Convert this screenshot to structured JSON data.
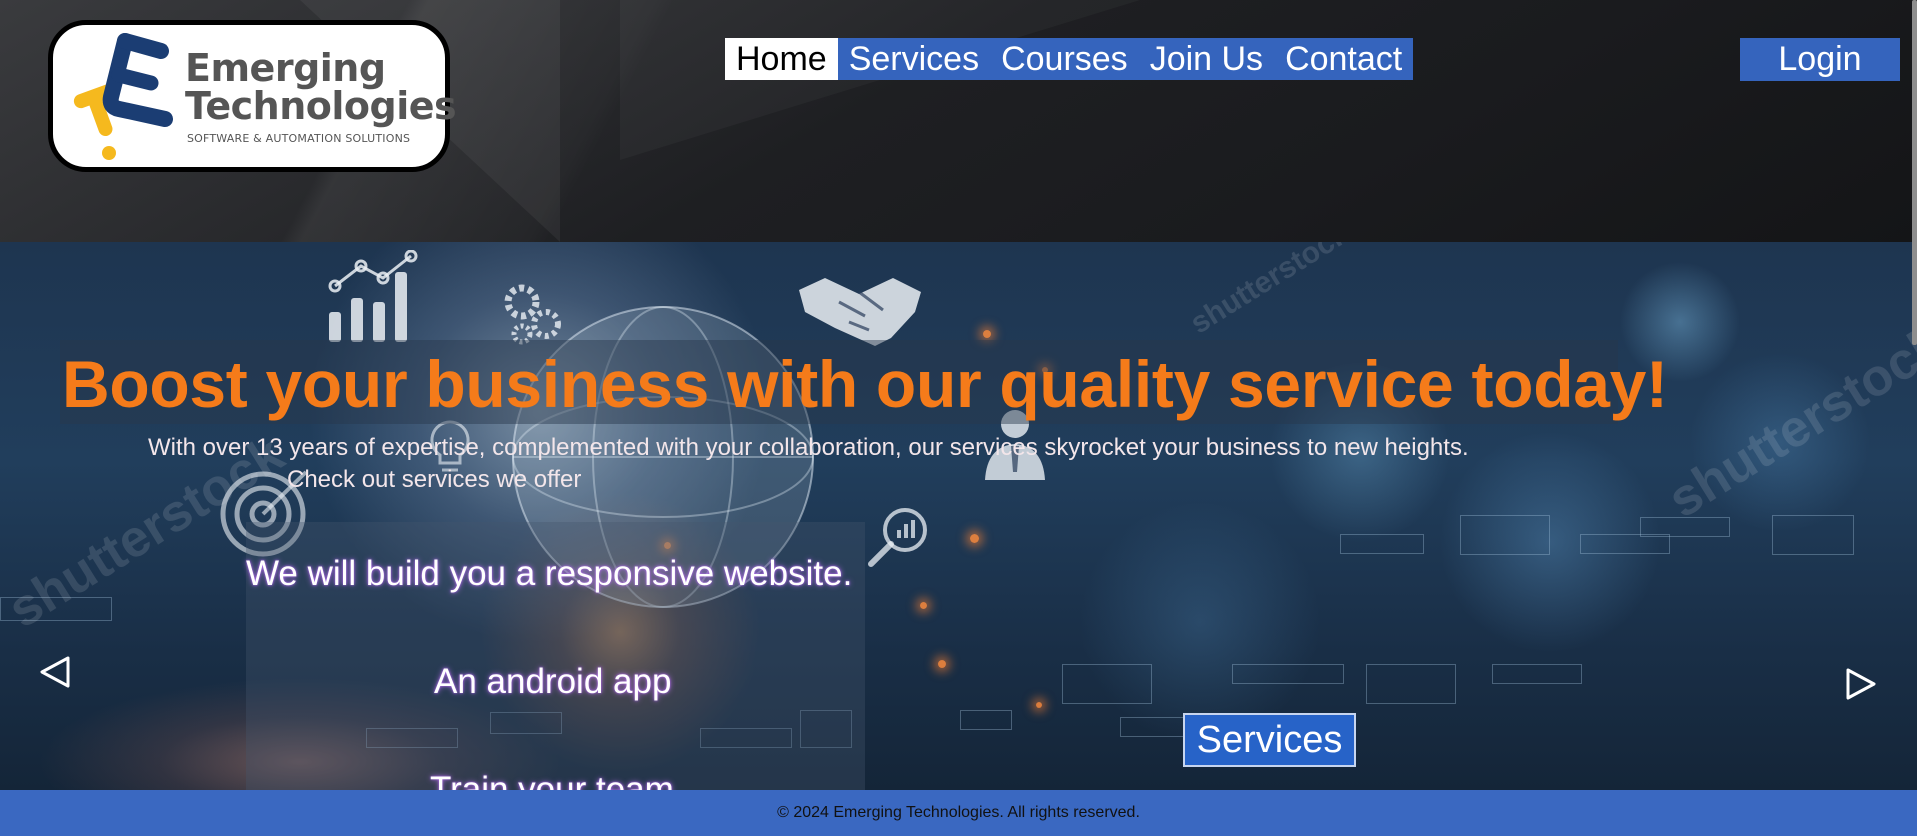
{
  "logo": {
    "line1": "Emerging",
    "line2": "Technologies",
    "tagline": "SOFTWARE & AUTOMATION SOLUTIONS"
  },
  "nav": {
    "items": [
      {
        "label": "Home",
        "active": true
      },
      {
        "label": "Services",
        "active": false
      },
      {
        "label": "Courses",
        "active": false
      },
      {
        "label": "Join Us",
        "active": false
      },
      {
        "label": "Contact",
        "active": false
      }
    ],
    "login_label": "Login"
  },
  "hero": {
    "headline": "Boost your business with our quality service today!",
    "subline": "With over 13 years of expertise, complemented with your collaboration, our services skyrocket your business to new heights.",
    "subline2": "Check out services we offer",
    "offers": [
      "We will build you a responsive website.",
      "An android app",
      "Train your team"
    ],
    "services_button": "Services",
    "watermark": "shutterstock"
  },
  "footer": {
    "text": "© 2024 Emerging Technologies. All rights reserved."
  },
  "colors": {
    "accent_blue": "#3564bd",
    "headline_orange": "#f57b1a",
    "logo_blue": "#1b3d73",
    "logo_yellow": "#f5b91e"
  }
}
